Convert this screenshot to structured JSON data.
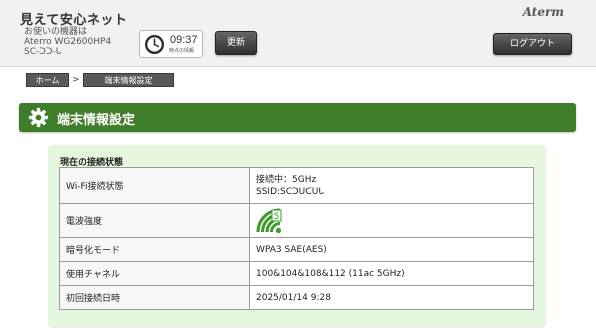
{
  "header": {
    "app_title": "見えて安心ネット",
    "device_label": "お使いの機器は",
    "device_model": "Aterro WG2600HP4",
    "device_id": "SC-ᑐᑐ‐ᒐ",
    "clock_time": "09:37",
    "clock_sub": "時点の情報",
    "refresh_label": "更新",
    "logout_label": "ログアウト",
    "brand": "Aterm"
  },
  "breadcrumb": {
    "home": "ホーム",
    "separator": ">",
    "current": "端末情報設定"
  },
  "section": {
    "title": "端末情報設定"
  },
  "status": {
    "title": "現在の接続状態",
    "rows": [
      {
        "label": "Wi-Fi接続状態",
        "lines": [
          "接続中：5GHz",
          "SSID:SCᑐᑌᑕᑌᒐ"
        ]
      },
      {
        "label": "電波強度",
        "signal": "wifi-signal-5ghz-icon"
      },
      {
        "label": "暗号化モード",
        "value": "WPA3 SAE(AES)"
      },
      {
        "label": "使用チャネル",
        "value": "100&104&108&112 (11ac 5GHz)"
      },
      {
        "label": "初回接続日時",
        "value": "2025/01/14 9:28"
      }
    ]
  },
  "colors": {
    "section_bar": "#3f7d2a",
    "panel_bg": "#e6f7df",
    "signal_green": "#3a9b2b"
  }
}
